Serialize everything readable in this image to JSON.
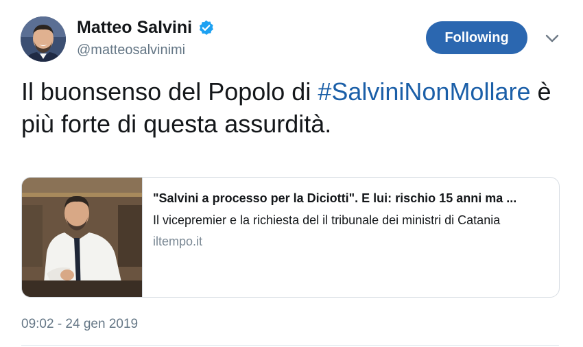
{
  "author": {
    "name": "Matteo Salvini",
    "handle": "@matteosalvinimi",
    "verified": true
  },
  "follow_button": {
    "label": "Following"
  },
  "tweet": {
    "text_before": "Il buonsenso del Popolo di ",
    "hashtag": "#SalviniNonMollare",
    "text_after": " è più forte di questa assurdità."
  },
  "card": {
    "title": "\"Salvini a processo per la Diciotti\". E lui: rischio 15 anni ma ...",
    "description": "Il vicepremier e la richiesta del il tribunale dei ministri di Catania",
    "domain": "iltempo.it"
  },
  "timestamp": "09:02 - 24 gen 2019",
  "colors": {
    "accent": "#2b67b0",
    "hashtag": "#1b5fa8",
    "verified": "#1da1f2",
    "secondary_text": "#657786"
  },
  "icons": {
    "verified": "verified-badge-icon",
    "more": "chevron-down-icon"
  }
}
